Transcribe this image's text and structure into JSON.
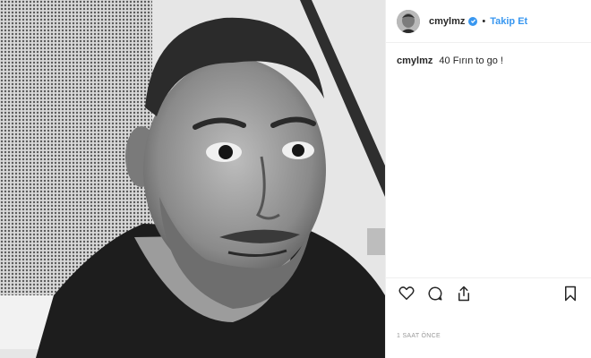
{
  "post": {
    "username": "cmylmz",
    "verified": true,
    "separator": "•",
    "follow_label": "Takip Et",
    "caption": {
      "username": "cmylmz",
      "text": "40 Fırın to go !"
    },
    "timestamp": "1 SAAT ÖNCE",
    "actions": [
      "heart-icon",
      "comment-icon",
      "share-icon",
      "bookmark-icon"
    ]
  },
  "colors": {
    "accent": "#3897f0",
    "text": "#262626",
    "muted": "#999999",
    "border": "#efefef"
  }
}
